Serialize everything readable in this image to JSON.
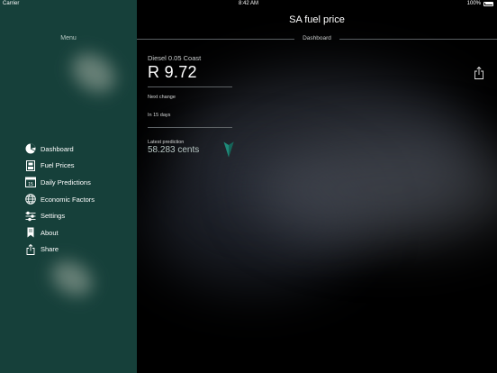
{
  "status_bar": {
    "carrier": "Carrier",
    "time": "8:42 AM",
    "battery": "100%"
  },
  "sidebar": {
    "title": "Menu",
    "items": [
      {
        "label": "Dashboard",
        "icon": "pie-chart-icon"
      },
      {
        "label": "Fuel Prices",
        "icon": "fuel-pump-icon"
      },
      {
        "label": "Daily Predictions",
        "icon": "calendar-icon"
      },
      {
        "label": "Economic Factors",
        "icon": "globe-icon"
      },
      {
        "label": "Settings",
        "icon": "sliders-icon"
      },
      {
        "label": "About",
        "icon": "bookmark-icon"
      },
      {
        "label": "Share",
        "icon": "share-icon"
      }
    ],
    "calendar_day": "15"
  },
  "header": {
    "title": "SA fuel price",
    "subtitle": "Dashboard"
  },
  "dashboard": {
    "fuel_name": "Diesel 0.05 Coast",
    "price": "R 9.72",
    "next_change_label": "Next change",
    "next_change_value": "In 15 days",
    "prediction_label": "Latest prediction",
    "prediction_value": "58.283 cents",
    "prediction_direction": "down",
    "accent_color": "#1f8a7a"
  }
}
